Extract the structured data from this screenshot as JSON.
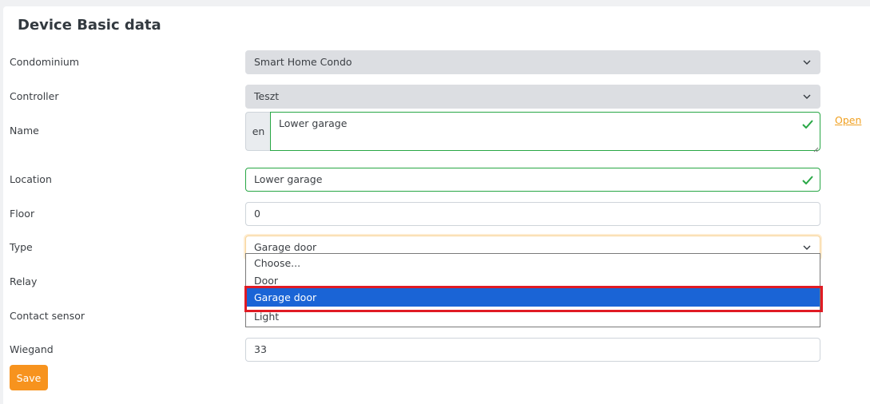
{
  "card": {
    "title": "Device Basic data"
  },
  "form": {
    "condominium": {
      "label": "Condominium",
      "value": "Smart Home Condo"
    },
    "controller": {
      "label": "Controller",
      "value": "Teszt"
    },
    "name": {
      "label": "Name",
      "lang": "en",
      "value": "Lower garage",
      "open_link": "Open"
    },
    "location": {
      "label": "Location",
      "value": "Lower garage"
    },
    "floor": {
      "label": "Floor",
      "value": "0"
    },
    "type": {
      "label": "Type",
      "value": "Garage door",
      "options": [
        "Choose...",
        "Door",
        "Garage door",
        "Light"
      ],
      "selected_index": 2
    },
    "relay": {
      "label": "Relay"
    },
    "contact_sensor": {
      "label": "Contact sensor"
    },
    "wiegand": {
      "label": "Wiegand",
      "value": "33"
    }
  },
  "actions": {
    "save_label": "Save"
  },
  "colors": {
    "accent": "#f7931e",
    "valid": "#28a745",
    "selection": "#1a64d6",
    "annotation_box": "#e01b24"
  },
  "icons": {
    "select_arrow": "chevron-down-icon",
    "valid_mark": "check-icon"
  }
}
